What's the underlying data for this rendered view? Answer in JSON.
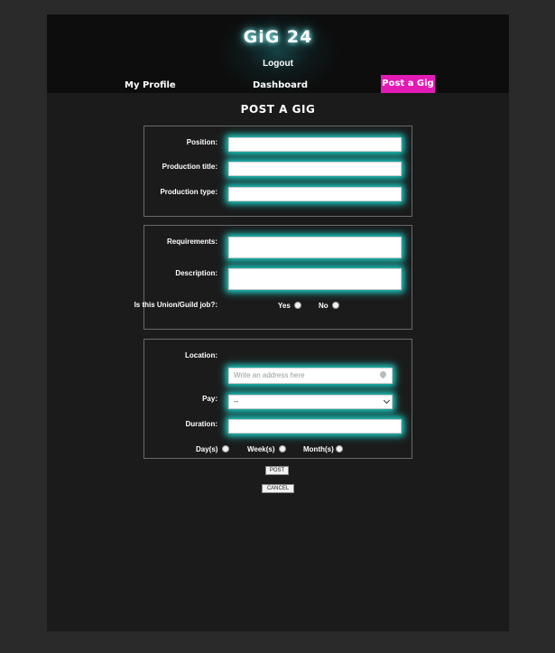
{
  "header": {
    "logo": "GiG 24",
    "logout": "Logout",
    "nav": {
      "profile": "My Profile",
      "dashboard": "Dashboard",
      "post_gig": "Post a Gig"
    }
  },
  "form": {
    "title": "POST A GIG",
    "section1": {
      "position_label": "Position:",
      "production_title_label": "Production title:",
      "production_type_label": "Production type:"
    },
    "section2": {
      "requirements_label": "Requirements:",
      "description_label": "Description:",
      "union_label": "Is this Union/Guild job?:",
      "yes_label": "Yes",
      "no_label": "No"
    },
    "section3": {
      "location_label": "Location:",
      "address_placeholder": "Write an address here",
      "pay_label": "Pay:",
      "pay_selected": "--",
      "duration_label": "Duration:",
      "days_label": "Day(s)",
      "weeks_label": "Week(s)",
      "months_label": "Month(s)"
    },
    "post_button": "POST",
    "cancel_button": "CANCEL"
  },
  "colors": {
    "accent_pink": "#e21bb4",
    "glow_teal": "#1fc9c0"
  }
}
